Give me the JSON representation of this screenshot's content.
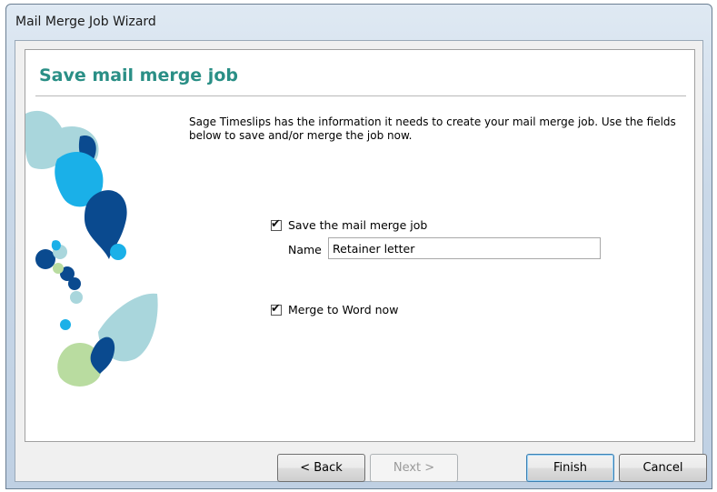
{
  "window": {
    "title": "Mail Merge Job Wizard"
  },
  "page": {
    "heading": "Save mail merge job",
    "intro": "Sage Timeslips has the information it needs to create your mail merge job. Use the fields below to save and/or merge the job now."
  },
  "form": {
    "save_job": {
      "label": "Save the mail merge job",
      "checked": true
    },
    "name": {
      "label": "Name",
      "value": "Retainer letter"
    },
    "merge_now": {
      "label": "Merge to Word now",
      "checked": true
    }
  },
  "buttons": {
    "back": "< Back",
    "next": "Next >",
    "finish": "Finish",
    "cancel": "Cancel"
  },
  "colors": {
    "heading": "#2a8f86",
    "accent_dark": "#0a4a8f",
    "accent_light": "#1ab0e8",
    "leaf_pale": "#a9d6dc",
    "leaf_green": "#b9dca0"
  }
}
